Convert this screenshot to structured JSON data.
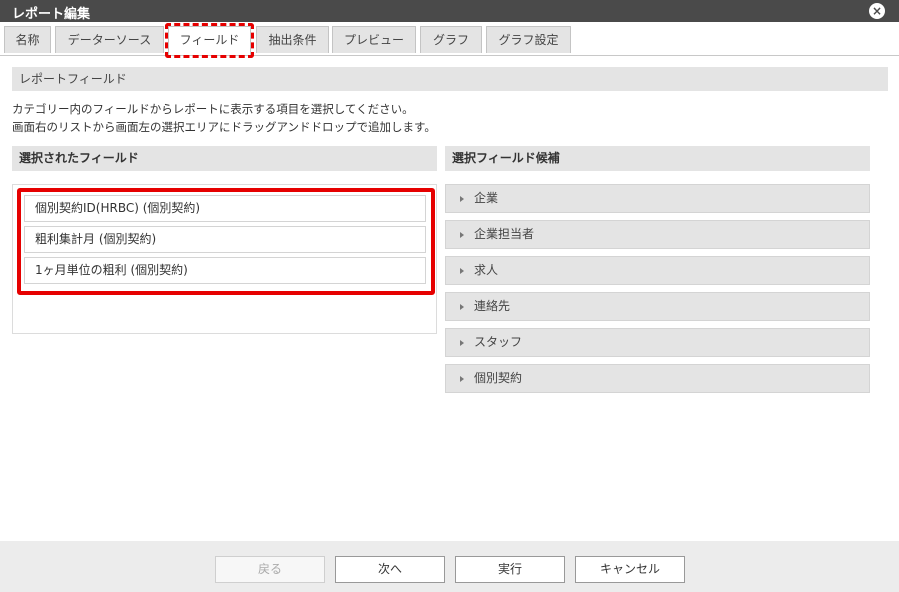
{
  "window": {
    "title": "レポート編集",
    "close_icon": "×"
  },
  "tabs": [
    {
      "label": "名称"
    },
    {
      "label": "データーソース"
    },
    {
      "label": "フィールド"
    },
    {
      "label": "抽出条件"
    },
    {
      "label": "プレビュー"
    },
    {
      "label": "グラフ"
    },
    {
      "label": "グラフ設定"
    }
  ],
  "active_tab": "フィールド",
  "section": {
    "title": "レポートフィールド",
    "description_line1": "カテゴリー内のフィールドからレポートに表示する項目を選択してください。",
    "description_line2": "画面右のリストから画面左の選択エリアにドラッグアンドドロップで追加します。"
  },
  "selected": {
    "heading": "選択されたフィールド",
    "items": [
      {
        "label": "個別契約ID(HRBC) (個別契約)"
      },
      {
        "label": "粗利集計月 (個別契約)"
      },
      {
        "label": "1ヶ月単位の粗利 (個別契約)"
      }
    ]
  },
  "candidates": {
    "heading": "選択フィールド候補",
    "items": [
      {
        "label": "企業"
      },
      {
        "label": "企業担当者"
      },
      {
        "label": "求人"
      },
      {
        "label": "連絡先"
      },
      {
        "label": "スタッフ"
      },
      {
        "label": "個別契約"
      }
    ]
  },
  "footer": {
    "back_label": "戻る",
    "next_label": "次へ",
    "run_label": "実行",
    "cancel_label": "キャンセル"
  },
  "colors": {
    "highlight": "#e60000",
    "titlebar": "#4a4a4a"
  }
}
